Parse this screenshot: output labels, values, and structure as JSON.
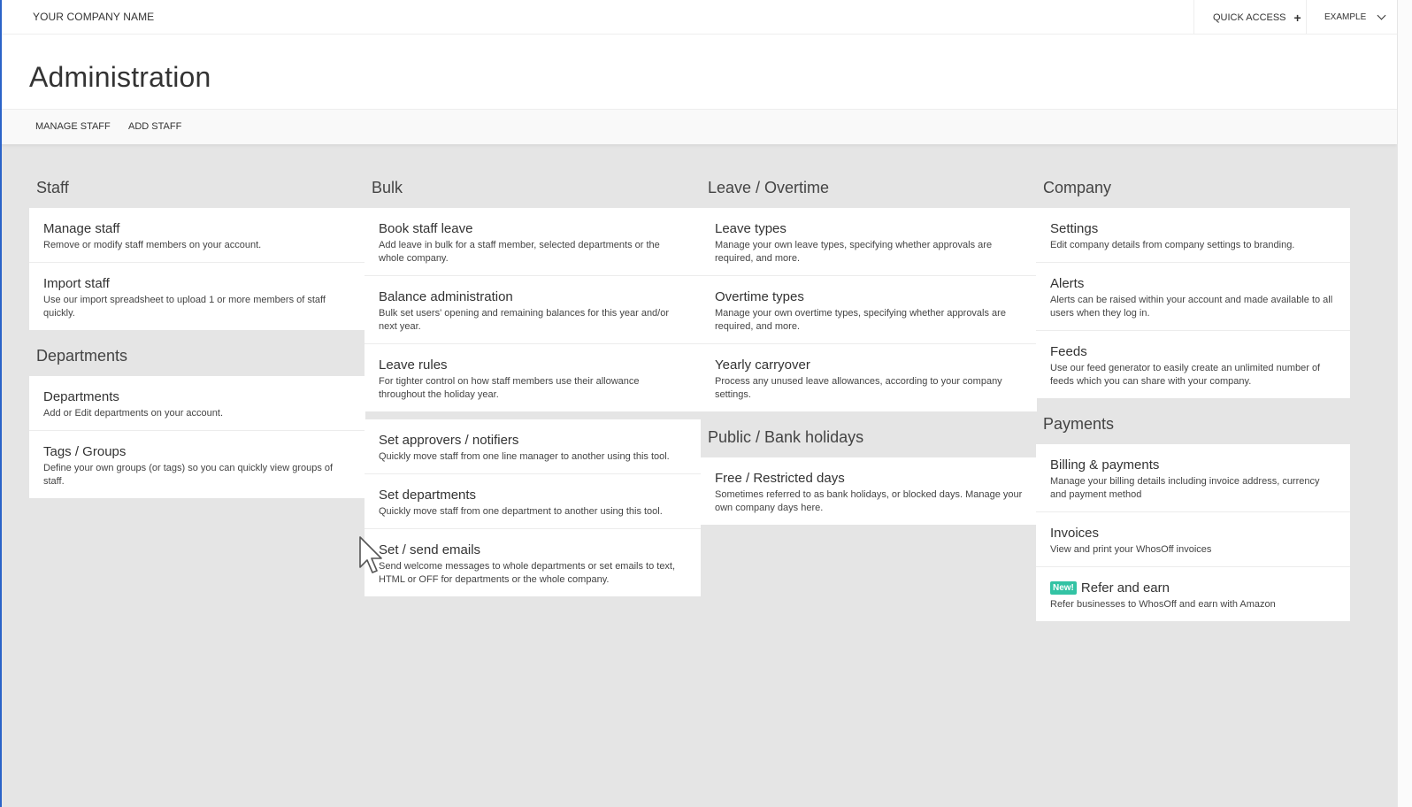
{
  "header": {
    "company": "YOUR COMPANY NAME",
    "quick_access": "QUICK ACCESS",
    "user": "EXAMPLE"
  },
  "page_title": "Administration",
  "subnav": [
    "MANAGE STAFF",
    "ADD STAFF"
  ],
  "staff": {
    "title": "Staff",
    "items": [
      {
        "title": "Manage staff",
        "desc": "Remove or modify staff members on your account."
      },
      {
        "title": "Import staff",
        "desc": "Use our import spreadsheet to upload 1 or more members of staff quickly."
      }
    ]
  },
  "departments": {
    "title": "Departments",
    "items": [
      {
        "title": "Departments",
        "desc": "Add or Edit departments on your account."
      },
      {
        "title": "Tags / Groups",
        "desc": "Define your own groups (or tags) so you can quickly view groups of staff."
      }
    ]
  },
  "bulk": {
    "title": "Bulk",
    "group1": [
      {
        "title": "Book staff leave",
        "desc": "Add leave in bulk for a staff member, selected departments or the whole company."
      },
      {
        "title": "Balance administration",
        "desc": "Bulk set users' opening and remaining balances for this year and/or next year."
      },
      {
        "title": "Leave rules",
        "desc": "For tighter control on how staff members use their allowance throughout the holiday year."
      }
    ],
    "group2": [
      {
        "title": "Set approvers / notifiers",
        "desc": "Quickly move staff from one line manager to another using this tool."
      },
      {
        "title": "Set departments",
        "desc": "Quickly move staff from one department to another using this tool."
      },
      {
        "title": "Set / send emails",
        "desc": "Send welcome messages to whole departments or set emails to text, HTML or OFF for departments or the whole company."
      }
    ]
  },
  "leave_overtime": {
    "title": "Leave / Overtime",
    "items": [
      {
        "title": "Leave types",
        "desc": "Manage your own leave types, specifying whether approvals are required, and more."
      },
      {
        "title": "Overtime types",
        "desc": "Manage your own overtime types, specifying whether approvals are required, and more."
      },
      {
        "title": "Yearly carryover",
        "desc": "Process any unused leave allowances, according to your company settings."
      }
    ]
  },
  "holidays": {
    "title": "Public / Bank holidays",
    "items": [
      {
        "title": "Free / Restricted days",
        "desc": "Sometimes referred to as bank holidays, or blocked days. Manage your own company days here."
      }
    ]
  },
  "company": {
    "title": "Company",
    "items": [
      {
        "title": "Settings",
        "desc": "Edit company details from company settings to branding."
      },
      {
        "title": "Alerts",
        "desc": "Alerts can be raised within your account and made available to all users when they log in."
      },
      {
        "title": "Feeds",
        "desc": "Use our feed generator to easily create an unlimited number of feeds which you can share with your company."
      }
    ]
  },
  "payments": {
    "title": "Payments",
    "items": [
      {
        "title": "Billing & payments",
        "desc": "Manage your billing details including invoice address, currency and payment method"
      },
      {
        "title": "Invoices",
        "desc": "View and print your WhosOff invoices"
      },
      {
        "title": "Refer and earn",
        "desc": "Refer businesses to WhosOff and earn with Amazon",
        "badge": "New!"
      }
    ]
  },
  "colors": {
    "badge": "#33c3a4",
    "background": "#e5e5e5",
    "edge": "#2b63c8"
  },
  "icons": {
    "plus": "plus-icon",
    "chevron": "chevron-down-icon",
    "cursor": "mouse-pointer-icon"
  }
}
